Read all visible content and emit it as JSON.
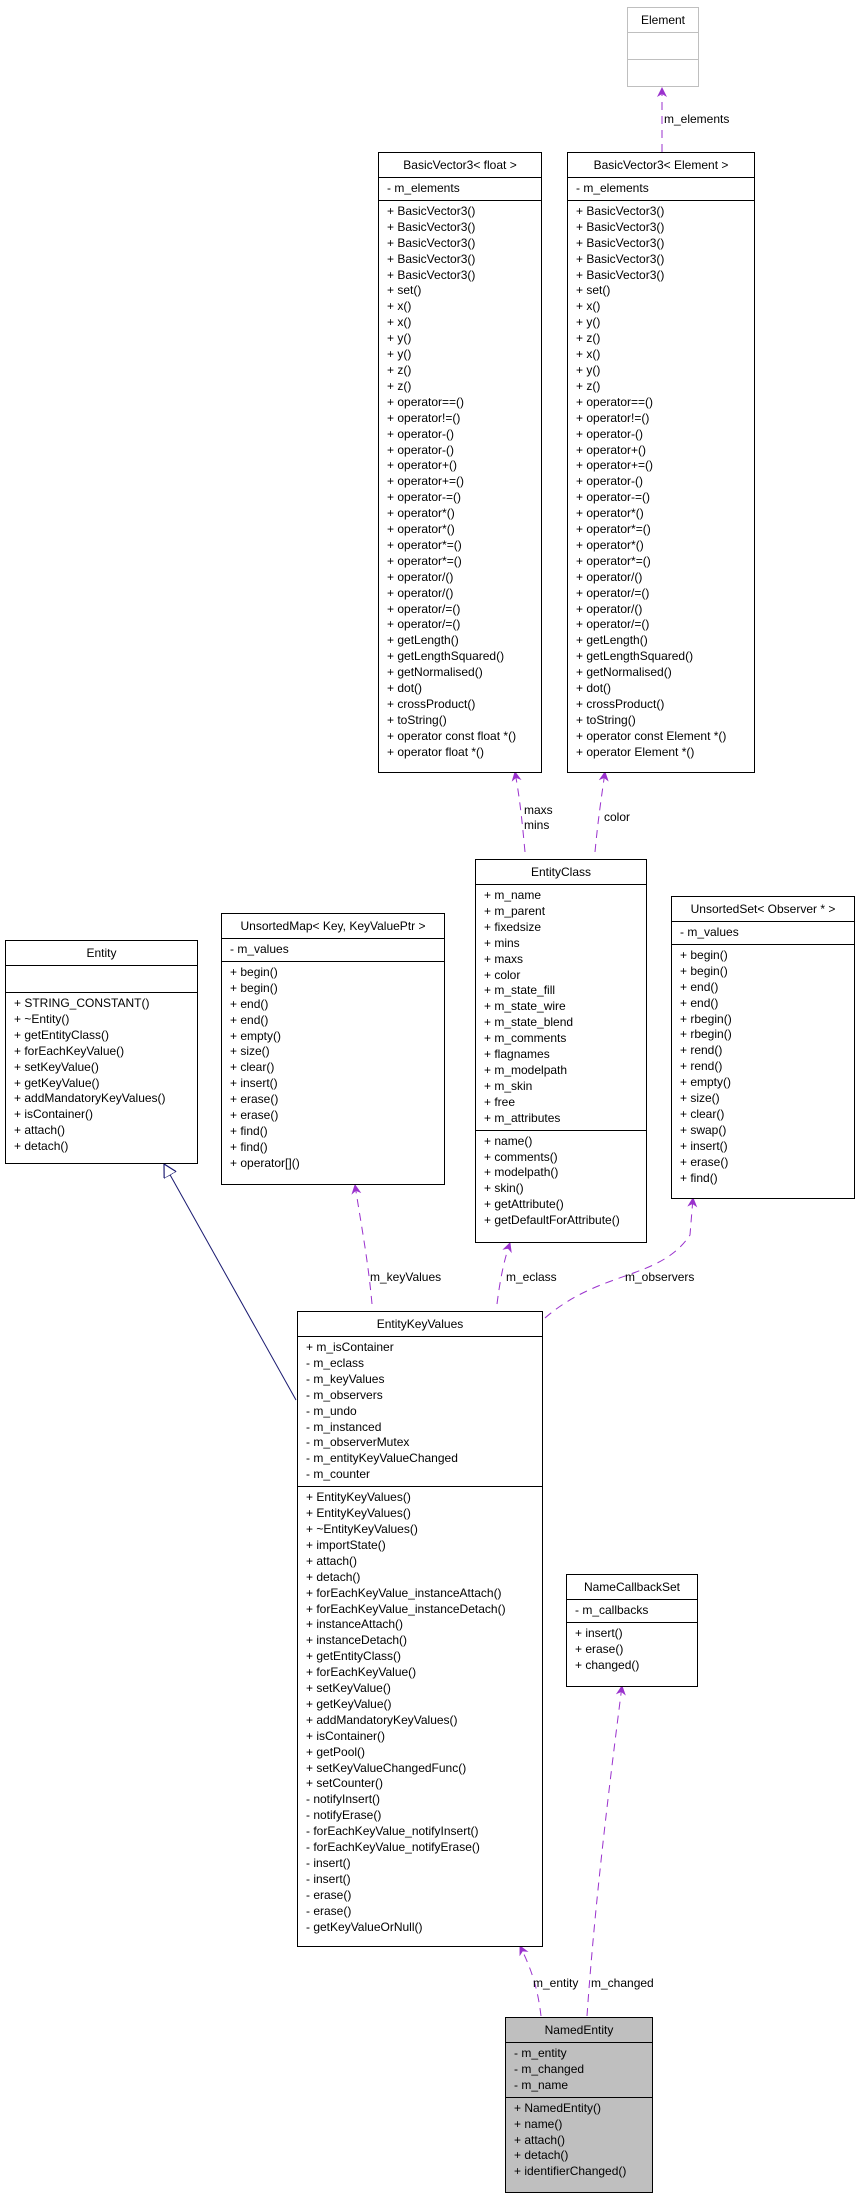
{
  "classes": {
    "element": {
      "name": "Element",
      "attributes": [],
      "methods": []
    },
    "bv3_float": {
      "name": "BasicVector3< float >",
      "attributes": [
        "- m_elements"
      ],
      "methods": [
        "+ BasicVector3()",
        "+ BasicVector3()",
        "+ BasicVector3()",
        "+ BasicVector3()",
        "+ BasicVector3()",
        "+ set()",
        "+ x()",
        "+ x()",
        "+ y()",
        "+ y()",
        "+ z()",
        "+ z()",
        "+ operator==()",
        "+ operator!=()",
        "+ operator-()",
        "+ operator-()",
        "+ operator+()",
        "+ operator+=()",
        "+ operator-=()",
        "+ operator*()",
        "+ operator*()",
        "+ operator*=()",
        "+ operator*=()",
        "+ operator/()",
        "+ operator/()",
        "+ operator/=()",
        "+ operator/=()",
        "+ getLength()",
        "+ getLengthSquared()",
        "+ getNormalised()",
        "+ dot()",
        "+ crossProduct()",
        "+ toString()",
        "+ operator const float *()",
        "+ operator float *()"
      ]
    },
    "bv3_element": {
      "name": "BasicVector3< Element >",
      "attributes": [
        "- m_elements"
      ],
      "methods": [
        "+ BasicVector3()",
        "+ BasicVector3()",
        "+ BasicVector3()",
        "+ BasicVector3()",
        "+ BasicVector3()",
        "+ set()",
        "+ x()",
        "+ y()",
        "+ z()",
        "+ x()",
        "+ y()",
        "+ z()",
        "+ operator==()",
        "+ operator!=()",
        "+ operator-()",
        "+ operator+()",
        "+ operator+=()",
        "+ operator-()",
        "+ operator-=()",
        "+ operator*()",
        "+ operator*=()",
        "+ operator*()",
        "+ operator*=()",
        "+ operator/()",
        "+ operator/=()",
        "+ operator/()",
        "+ operator/=()",
        "+ getLength()",
        "+ getLengthSquared()",
        "+ getNormalised()",
        "+ dot()",
        "+ crossProduct()",
        "+ toString()",
        "+ operator const Element *()",
        "+ operator Element *()"
      ]
    },
    "entity": {
      "name": "Entity",
      "attributes": [],
      "methods": [
        "+ STRING_CONSTANT()",
        "+ ~Entity()",
        "+ getEntityClass()",
        "+ forEachKeyValue()",
        "+ setKeyValue()",
        "+ getKeyValue()",
        "+ addMandatoryKeyValues()",
        "+ isContainer()",
        "+ attach()",
        "+ detach()"
      ]
    },
    "unsorted_map": {
      "name": "UnsortedMap< Key, KeyValuePtr >",
      "attributes": [
        "- m_values"
      ],
      "methods": [
        "+ begin()",
        "+ begin()",
        "+ end()",
        "+ end()",
        "+ empty()",
        "+ size()",
        "+ clear()",
        "+ insert()",
        "+ erase()",
        "+ erase()",
        "+ find()",
        "+ find()",
        "+ operator[]()"
      ]
    },
    "entity_class": {
      "name": "EntityClass",
      "attributes": [
        "+ m_name",
        "+ m_parent",
        "+ fixedsize",
        "+ mins",
        "+ maxs",
        "+ color",
        "+ m_state_fill",
        "+ m_state_wire",
        "+ m_state_blend",
        "+ m_comments",
        "+ flagnames",
        "+ m_modelpath",
        "+ m_skin",
        "+ free",
        "+ m_attributes"
      ],
      "methods": [
        "+ name()",
        "+ comments()",
        "+ modelpath()",
        "+ skin()",
        "+ getAttribute()",
        "+ getDefaultForAttribute()"
      ]
    },
    "unsorted_set": {
      "name": "UnsortedSet< Observer * >",
      "attributes": [
        "- m_values"
      ],
      "methods": [
        "+ begin()",
        "+ begin()",
        "+ end()",
        "+ end()",
        "+ rbegin()",
        "+ rbegin()",
        "+ rend()",
        "+ rend()",
        "+ empty()",
        "+ size()",
        "+ clear()",
        "+ swap()",
        "+ insert()",
        "+ erase()",
        "+ find()"
      ]
    },
    "entity_key_values": {
      "name": "EntityKeyValues",
      "attributes": [
        "+ m_isContainer",
        "- m_eclass",
        "- m_keyValues",
        "- m_observers",
        "- m_undo",
        "- m_instanced",
        "- m_observerMutex",
        "- m_entityKeyValueChanged",
        "- m_counter"
      ],
      "methods": [
        "+ EntityKeyValues()",
        "+ EntityKeyValues()",
        "+ ~EntityKeyValues()",
        "+ importState()",
        "+ attach()",
        "+ detach()",
        "+ forEachKeyValue_instanceAttach()",
        "+ forEachKeyValue_instanceDetach()",
        "+ instanceAttach()",
        "+ instanceDetach()",
        "+ getEntityClass()",
        "+ forEachKeyValue()",
        "+ setKeyValue()",
        "+ getKeyValue()",
        "+ addMandatoryKeyValues()",
        "+ isContainer()",
        "+ getPool()",
        "+ setKeyValueChangedFunc()",
        "+ setCounter()",
        "- notifyInsert()",
        "- notifyErase()",
        "- forEachKeyValue_notifyInsert()",
        "- forEachKeyValue_notifyErase()",
        "- insert()",
        "- insert()",
        "- erase()",
        "- erase()",
        "- getKeyValueOrNull()"
      ]
    },
    "name_callback_set": {
      "name": "NameCallbackSet",
      "attributes": [
        "- m_callbacks"
      ],
      "methods": [
        "+ insert()",
        "+ erase()",
        "+ changed()"
      ]
    },
    "named_entity": {
      "name": "NamedEntity",
      "attributes": [
        "- m_entity",
        "- m_changed",
        "- m_name"
      ],
      "methods": [
        "+ NamedEntity()",
        "+ name()",
        "+ attach()",
        "+ detach()",
        "+ identifierChanged()"
      ]
    }
  },
  "edge_labels": {
    "m_elements": "m_elements",
    "maxs": "maxs",
    "mins": "mins",
    "color": "color",
    "m_keyValues": "m_keyValues",
    "m_eclass": "m_eclass",
    "m_observers": "m_observers",
    "m_entity": "m_entity",
    "m_changed": "m_changed"
  },
  "colors": {
    "usage_edge": "#9a32cd",
    "inheritance_edge": "#191970",
    "highlight_class": "#bfbfbf"
  }
}
